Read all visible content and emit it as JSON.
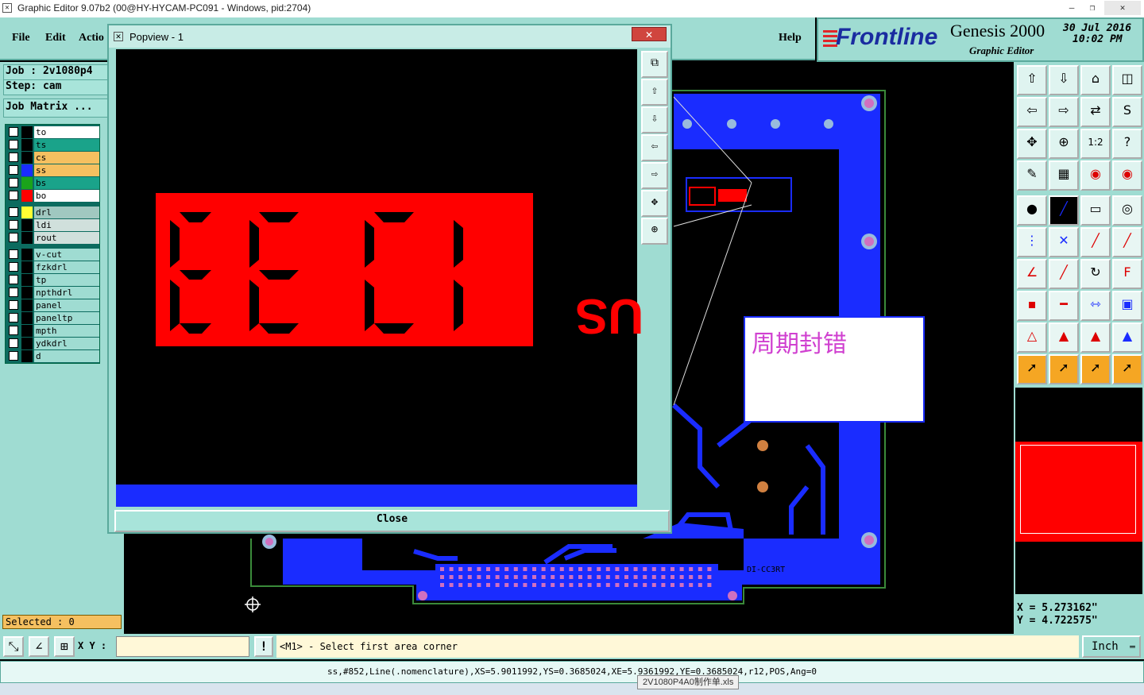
{
  "window": {
    "title": "Graphic Editor 9.07b2 (00@HY-HYCAM-PC091 - Windows, pid:2704)",
    "buttons": [
      "—",
      "❐",
      "✕"
    ]
  },
  "menu": {
    "file": "File",
    "edit": "Edit",
    "actions": "Actio",
    "help": "Help"
  },
  "logo": {
    "brand": "Frontline",
    "product": "Genesis 2000",
    "subtitle": "Graphic Editor",
    "date": "30  Jul  2016",
    "time": "10:02  PM"
  },
  "left": {
    "job": "Job  :  2v1080p4",
    "step": "Step:  cam",
    "matrix": "Job Matrix ...",
    "layers": [
      {
        "name": "to",
        "swatch": "#000000",
        "bg": "#ffffff"
      },
      {
        "name": "ts",
        "swatch": "#000000",
        "bg": "#1aa38a"
      },
      {
        "name": "cs",
        "swatch": "#000000",
        "bg": "#f5c060"
      },
      {
        "name": "ss",
        "swatch": "#1a2cff",
        "bg": "#f5c060"
      },
      {
        "name": "bs",
        "swatch": "#1aa31a",
        "bg": "#1aa38a"
      },
      {
        "name": "bo",
        "swatch": "#ff0000",
        "bg": "#ffffff"
      },
      {
        "name": "drl",
        "swatch": "#ffff33",
        "bg": "#a0c8c0"
      },
      {
        "name": "ldi",
        "swatch": "#000000",
        "bg": "#d0e0dc"
      },
      {
        "name": "rout",
        "swatch": "#000000",
        "bg": "#d0e0dc"
      },
      {
        "name": "v-cut",
        "swatch": "#000000",
        "bg": "#9fdcd2"
      },
      {
        "name": "fzkdrl",
        "swatch": "#000000",
        "bg": "#9fdcd2"
      },
      {
        "name": "tp",
        "swatch": "#000000",
        "bg": "#9fdcd2"
      },
      {
        "name": "npthdrl",
        "swatch": "#000000",
        "bg": "#9fdcd2"
      },
      {
        "name": "panel",
        "swatch": "#000000",
        "bg": "#9fdcd2"
      },
      {
        "name": "paneltp",
        "swatch": "#000000",
        "bg": "#9fdcd2"
      },
      {
        "name": "mpth",
        "swatch": "#000000",
        "bg": "#9fdcd2"
      },
      {
        "name": "ydkdrl",
        "swatch": "#000000",
        "bg": "#9fdcd2"
      },
      {
        "name": "d",
        "swatch": "#000000",
        "bg": "#9fdcd2"
      }
    ],
    "selected": "Selected : 0"
  },
  "popup": {
    "title": "Popview - 1",
    "close": "Close",
    "mirrored_text": "US"
  },
  "canvas": {
    "note": "周期封错",
    "label": "DI-CC3RT"
  },
  "coords": {
    "x": "X  =  5.273162\"",
    "y": "Y  =  4.722575\""
  },
  "bottom": {
    "xy_label": "X Y :",
    "prompt": "<M1> - Select first area corner",
    "unit": "Inch",
    "message": "ss,#852,Line(.nomenclature),XS=5.9011992,YS=0.3685024,XE=5.9361992,YE=0.3685024,r12,POS,Ang=0",
    "taskbar_file": "2V1080P4A0制作单.xls"
  }
}
